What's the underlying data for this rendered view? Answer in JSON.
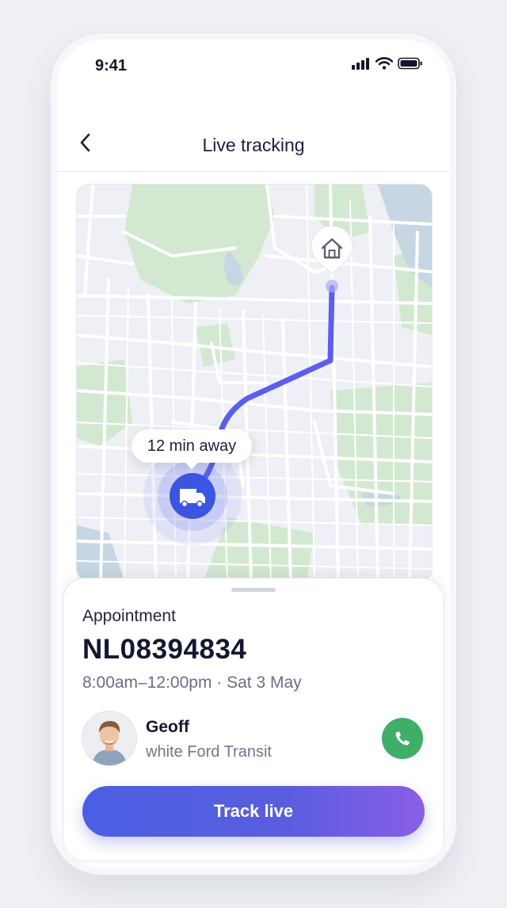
{
  "status_bar": {
    "time": "9:41"
  },
  "header": {
    "title": "Live tracking"
  },
  "map": {
    "eta_label": "12 min away"
  },
  "sheet": {
    "appointment_label": "Appointment",
    "appointment_number": "NL08394834",
    "appointment_time": "8:00am–12:00pm · Sat 3 May",
    "driver": {
      "name": "Geoff",
      "vehicle": "white Ford Transit"
    },
    "track_button_label": "Track live"
  },
  "colors": {
    "route": "#5b5ef0",
    "accent": "#4a5fe2",
    "call": "#3fae68",
    "map_green": "#cfe6cc",
    "map_water": "#bfd0dd"
  },
  "icons": [
    "back-chevron-icon",
    "home-icon",
    "van-icon",
    "phone-icon",
    "signal-icon",
    "wifi-icon",
    "battery-icon"
  ]
}
